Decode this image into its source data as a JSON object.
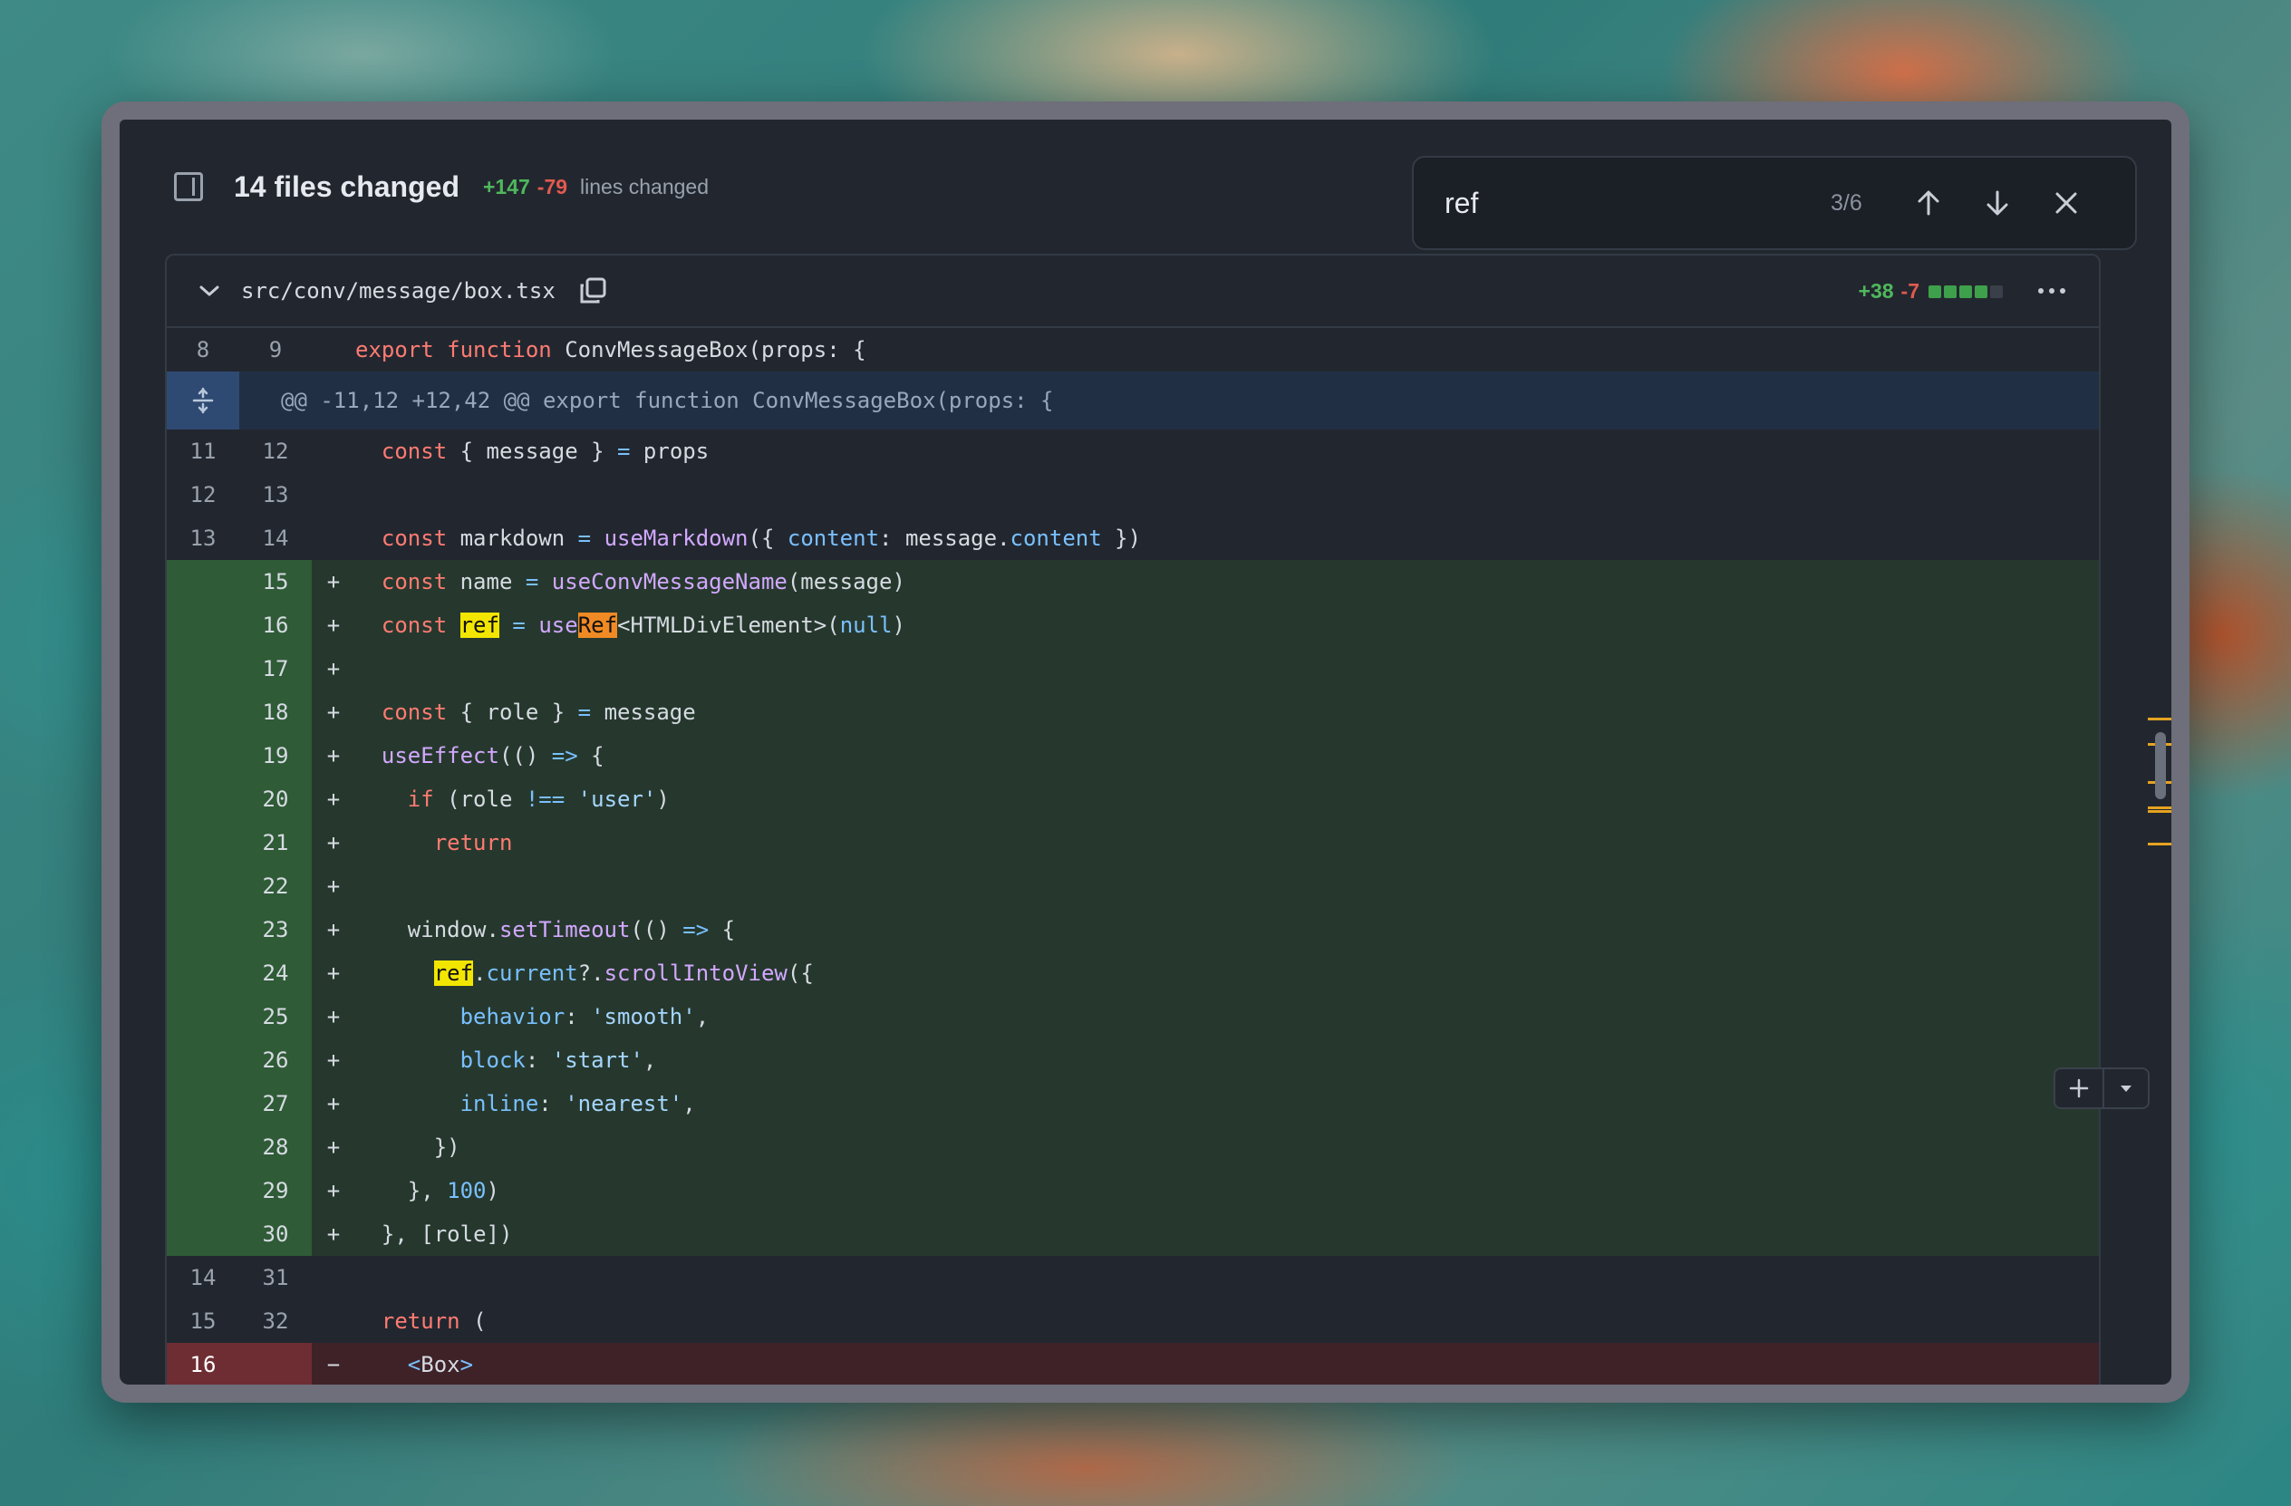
{
  "header": {
    "title": "14 files changed",
    "additions": "+147",
    "deletions": "-79",
    "lines_label": "lines changed"
  },
  "search": {
    "query": "ref",
    "count": "3/6"
  },
  "file": {
    "path": "src/conv/message/box.tsx",
    "additions": "+38",
    "deletions": "-7",
    "diffstat_blocks": 5,
    "diffstat_filled": 4
  },
  "diff": {
    "top_row": {
      "old": "8",
      "new": "9"
    },
    "hunk": "@@ -11,12 +12,42 @@ export function ConvMessageBox(props: {",
    "rows": [
      {
        "old": "11",
        "new": "12"
      },
      {
        "old": "12",
        "new": "13"
      },
      {
        "old": "13",
        "new": "14"
      },
      {
        "old": "",
        "new": "15",
        "sign": "+"
      },
      {
        "old": "",
        "new": "16",
        "sign": "+"
      },
      {
        "old": "",
        "new": "17",
        "sign": "+"
      },
      {
        "old": "",
        "new": "18",
        "sign": "+"
      },
      {
        "old": "",
        "new": "19",
        "sign": "+"
      },
      {
        "old": "",
        "new": "20",
        "sign": "+"
      },
      {
        "old": "",
        "new": "21",
        "sign": "+"
      },
      {
        "old": "",
        "new": "22",
        "sign": "+"
      },
      {
        "old": "",
        "new": "23",
        "sign": "+"
      },
      {
        "old": "",
        "new": "24",
        "sign": "+"
      },
      {
        "old": "",
        "new": "25",
        "sign": "+"
      },
      {
        "old": "",
        "new": "26",
        "sign": "+"
      },
      {
        "old": "",
        "new": "27",
        "sign": "+"
      },
      {
        "old": "",
        "new": "28",
        "sign": "+"
      },
      {
        "old": "",
        "new": "29",
        "sign": "+"
      },
      {
        "old": "",
        "new": "30",
        "sign": "+"
      },
      {
        "old": "14",
        "new": "31"
      },
      {
        "old": "15",
        "new": "32"
      },
      {
        "old": "16",
        "new": "",
        "sign": "−"
      }
    ],
    "code": {
      "l0": [
        "export",
        "function",
        "ConvMessageBox",
        "(props: {"
      ],
      "l1": [
        "const",
        "{ message }",
        "=",
        "props"
      ],
      "l3": [
        "const",
        "markdown",
        "=",
        "useMarkdown",
        "({",
        "content",
        ":",
        "message.",
        "content",
        "})"
      ],
      "l4": [
        "const",
        "name",
        "=",
        "useConvMessageName",
        "(message)"
      ],
      "l5": [
        "const",
        "ref",
        "=",
        "use",
        "Ref",
        "<HTMLDivElement>(",
        "null",
        ")"
      ],
      "l7": [
        "const",
        "{ role }",
        "=",
        "message"
      ],
      "l8": [
        "useEffect",
        "(()",
        "=>",
        "{"
      ],
      "l9": [
        "if",
        "(role",
        "!==",
        "'user'",
        ")"
      ],
      "l10": [
        "return"
      ],
      "l12": [
        "window.",
        "setTimeout",
        "(()",
        "=>",
        "{"
      ],
      "l13": [
        "ref",
        ".",
        "current",
        "?.",
        "scrollIntoView",
        "({"
      ],
      "l14": [
        "behavior",
        ":",
        "'smooth'",
        ","
      ],
      "l15": [
        "block",
        ":",
        "'start'",
        ","
      ],
      "l16": [
        "inline",
        ":",
        "'nearest'",
        ","
      ],
      "l17": [
        "})"
      ],
      "l18": [
        "},",
        "100",
        ")"
      ],
      "l19": [
        "},",
        "[role])"
      ],
      "l21": [
        "return",
        "("
      ],
      "l22": [
        "<",
        "Box",
        ">"
      ]
    }
  },
  "colors": {
    "addition": "#4fb85c",
    "deletion": "#e2594f",
    "match_highlight": "#f2e600",
    "current_match": "#f08a24"
  }
}
